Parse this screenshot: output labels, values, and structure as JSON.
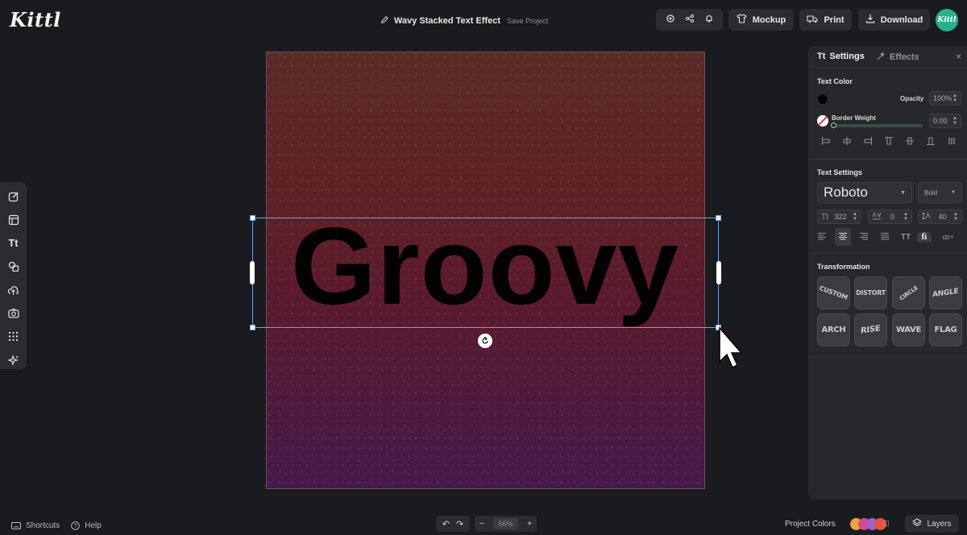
{
  "header": {
    "logo": "Kittl",
    "project_title": "Wavy Stacked Text Effect",
    "save_label": "Save Project",
    "mockup_label": "Mockup",
    "print_label": "Print",
    "download_label": "Download",
    "avatar_label": "Kittl"
  },
  "left_toolbar": {
    "items": [
      "edit-icon",
      "templates-icon",
      "text-icon",
      "shapes-icon",
      "upload-icon",
      "photos-icon",
      "pattern-icon",
      "ai-sparkle-icon"
    ],
    "text_glyph": "Tt"
  },
  "canvas": {
    "text": "Groovy",
    "background_colors": [
      "#5a2a25",
      "#5b1a2d",
      "#471a4c"
    ]
  },
  "panel": {
    "tab_settings": "Settings",
    "tab_effects": "Effects",
    "text_color_label": "Text Color",
    "text_color_value": "#000000",
    "opacity_label": "Opacity",
    "opacity_value": "100%",
    "border_weight_label": "Border Weight",
    "border_weight_value": "0.00",
    "text_settings_label": "Text Settings",
    "font_family": "Roboto",
    "font_weight": "Bold",
    "font_size": "322",
    "letter_spacing": "0",
    "line_height": "40",
    "transformation_label": "Transformation",
    "transformations": [
      "CUSTOM",
      "DISTORT",
      "CIRCLE",
      "ANGLE",
      "ARCH",
      "RISE",
      "WAVE",
      "FLAG"
    ],
    "tt_glyph": "TT",
    "fi_glyph": "fi"
  },
  "bottom": {
    "shortcuts_label": "Shortcuts",
    "help_label": "Help",
    "zoom_value": "66%",
    "project_colors_label": "Project Colors",
    "layers_label": "Layers",
    "swatch_colors": [
      "#e8a33a",
      "#d24a8a",
      "#9b5fd0",
      "#e8503a"
    ]
  }
}
